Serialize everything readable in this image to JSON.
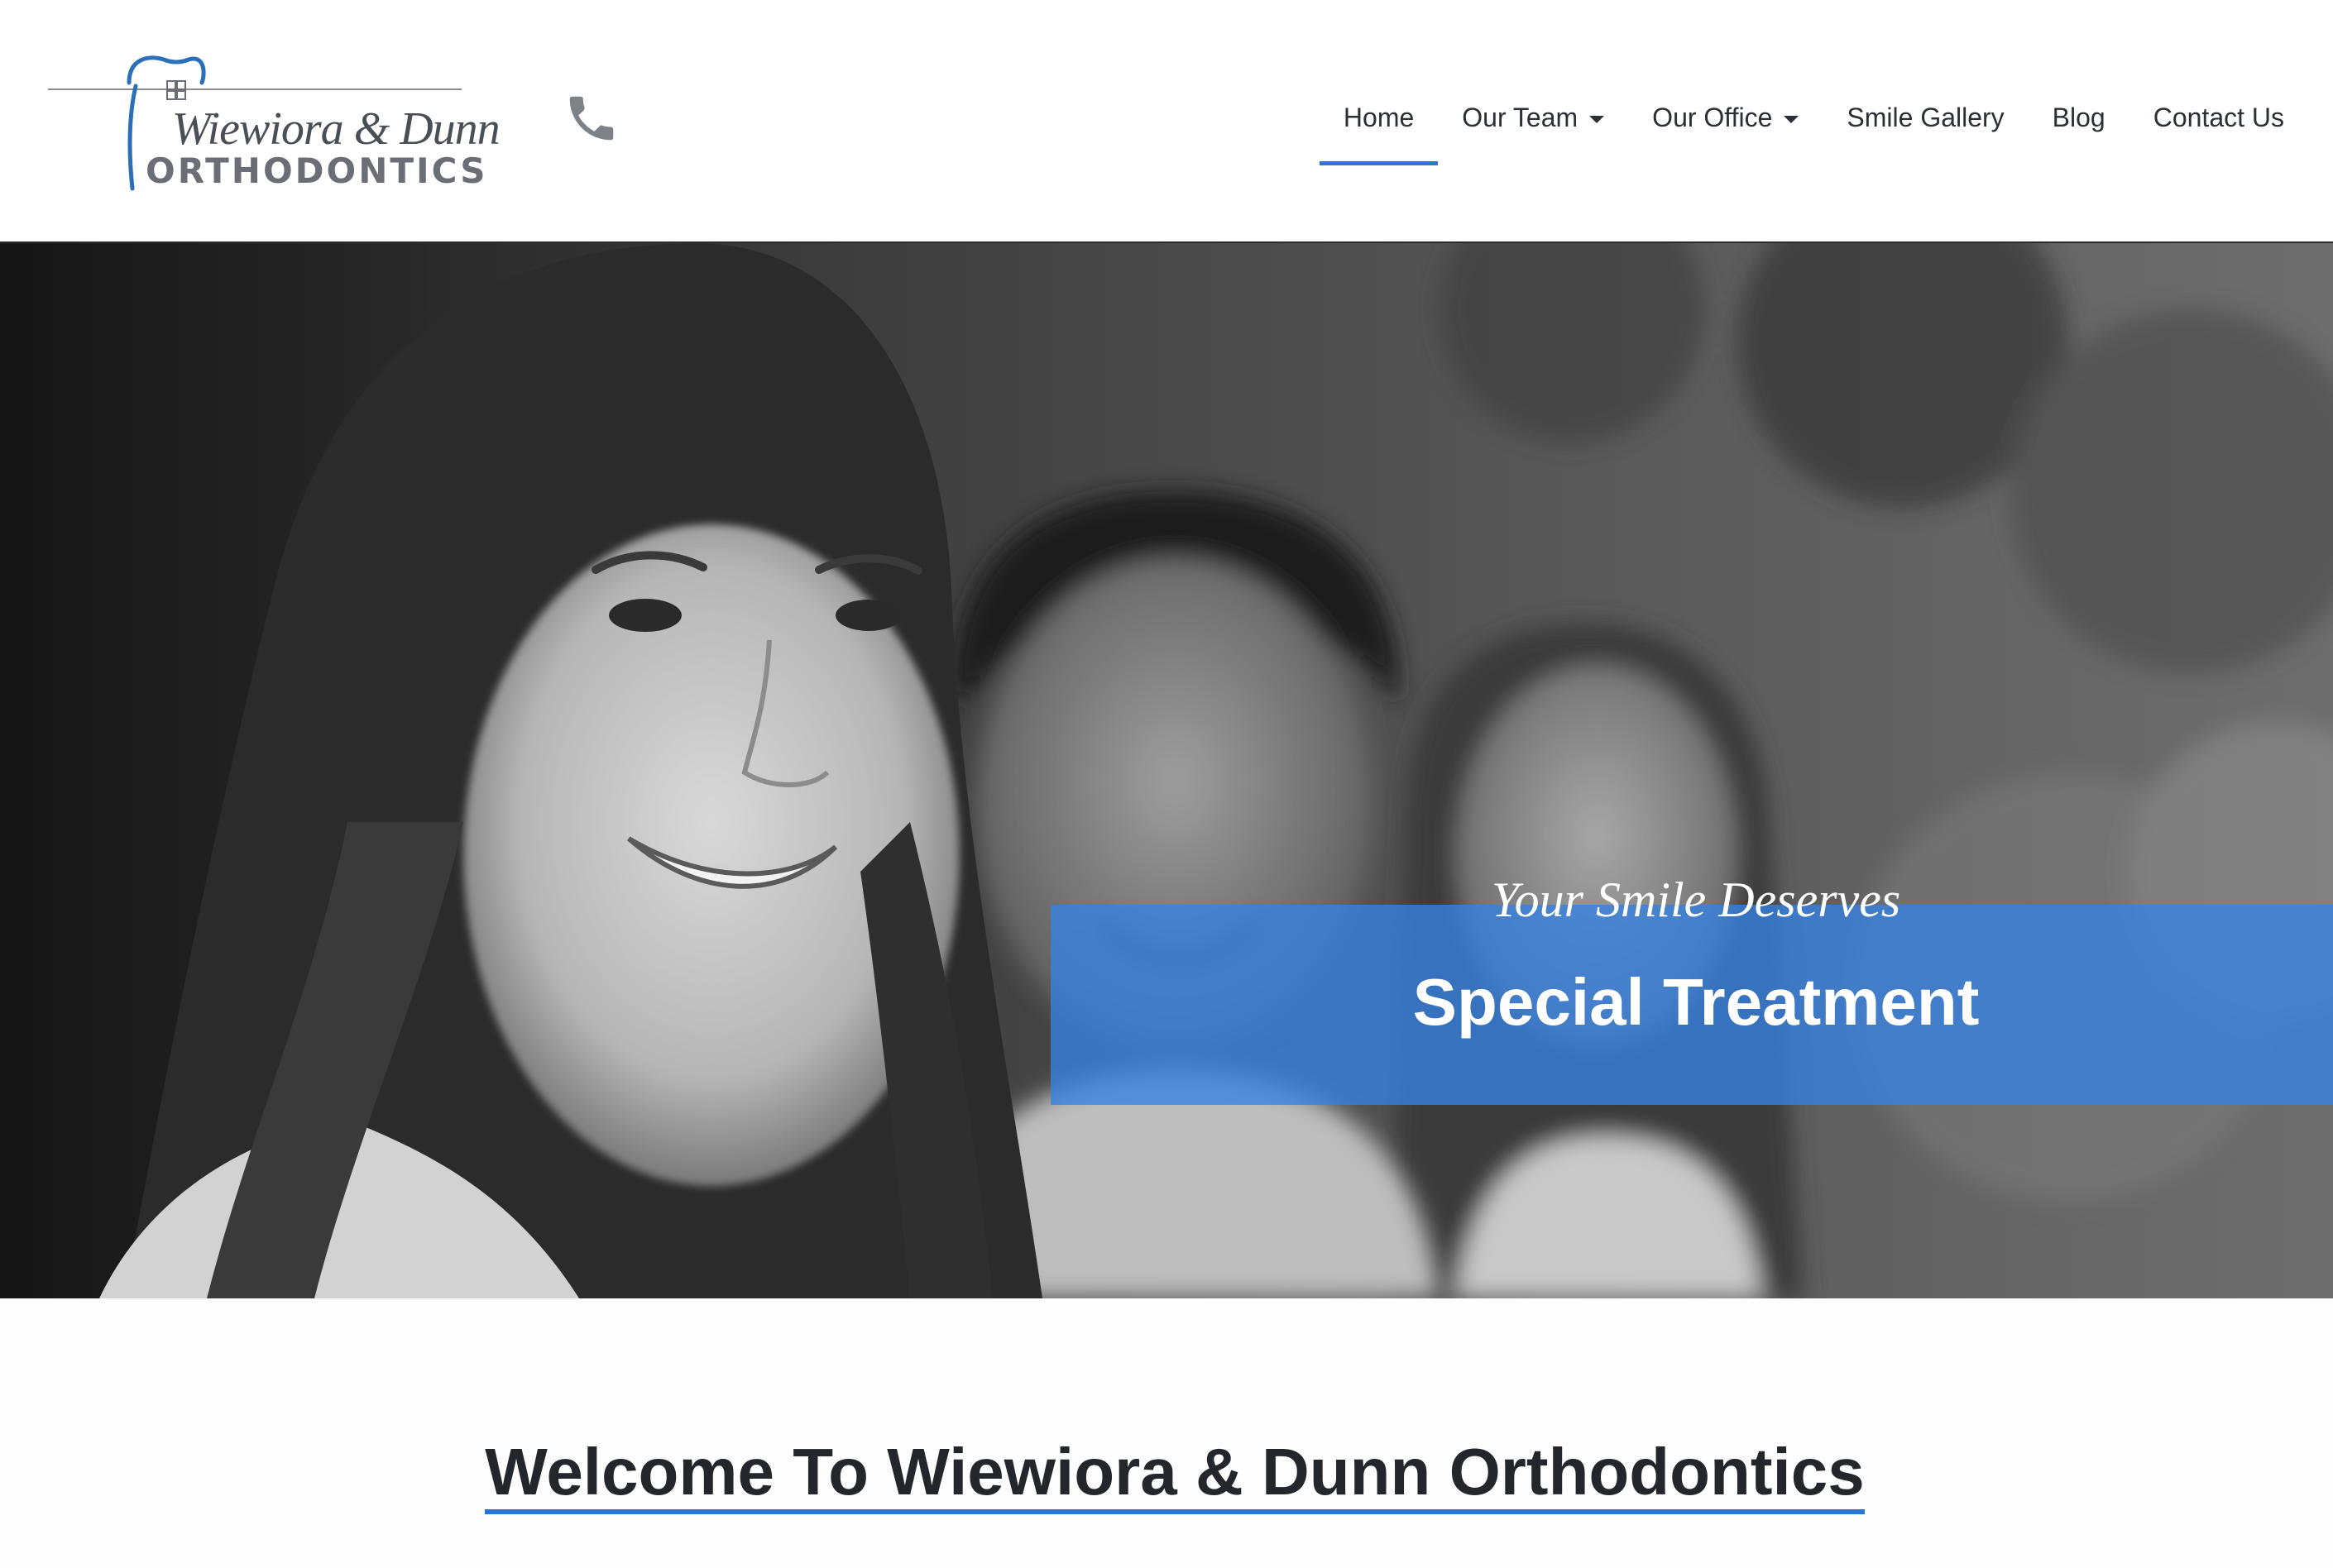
{
  "logo": {
    "script_text": "Wiewiora & Dunn",
    "block_text": "ORTHODONTICS"
  },
  "icons": {
    "phone": "phone-icon",
    "logo_tooth": "tooth-icon"
  },
  "nav": {
    "items": [
      {
        "label": "Home",
        "active": true,
        "dropdown": false
      },
      {
        "label": "Our Team",
        "active": false,
        "dropdown": true
      },
      {
        "label": "Our Office",
        "active": false,
        "dropdown": true
      },
      {
        "label": "Smile Gallery",
        "active": false,
        "dropdown": false
      },
      {
        "label": "Blog",
        "active": false,
        "dropdown": false
      },
      {
        "label": "Contact Us",
        "active": false,
        "dropdown": false
      }
    ]
  },
  "hero": {
    "tagline_italic": "Your Smile Deserves",
    "tagline_bold": "Special Treatment"
  },
  "welcome": {
    "title": "Welcome To Wiewiora & Dunn Orthodontics"
  },
  "colors": {
    "accent": "#2a76d8",
    "tagline_box": "#3482e2",
    "nav_text": "#2b2f36",
    "heading_text": "#23262b",
    "logo_blue": "#2a6fb8",
    "logo_gray": "#6b6f75"
  }
}
